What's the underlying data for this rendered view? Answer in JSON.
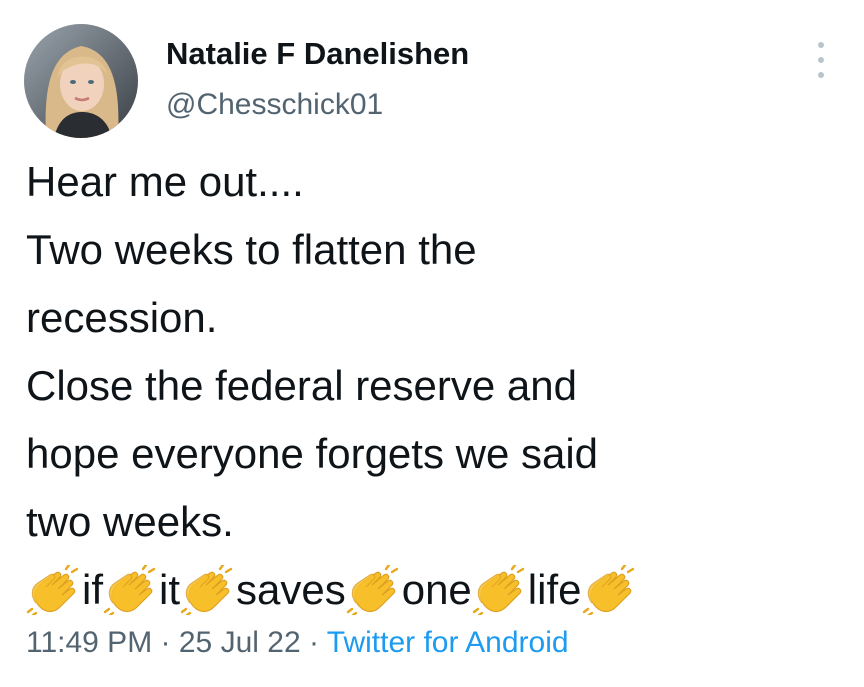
{
  "author": {
    "display_name": "Natalie F Danelishen",
    "handle": "@Chesschick01",
    "avatar_icon": "profile-photo"
  },
  "tweet": {
    "lines": [
      "Hear me out....",
      "Two weeks to flatten the",
      "recession.",
      "Close the federal reserve and",
      "hope everyone forgets we said",
      "two weeks."
    ],
    "clap_words": [
      "if",
      "it",
      "saves",
      "one",
      "life"
    ],
    "clap_emoji": "clapping-hands-icon"
  },
  "meta": {
    "time": "11:49 PM",
    "separator": "·",
    "date": "25 Jul 22",
    "source": "Twitter for Android"
  },
  "colors": {
    "text": "#0f1419",
    "secondary": "#536471",
    "link": "#1d9bf0",
    "clap": "#f7c02b"
  }
}
